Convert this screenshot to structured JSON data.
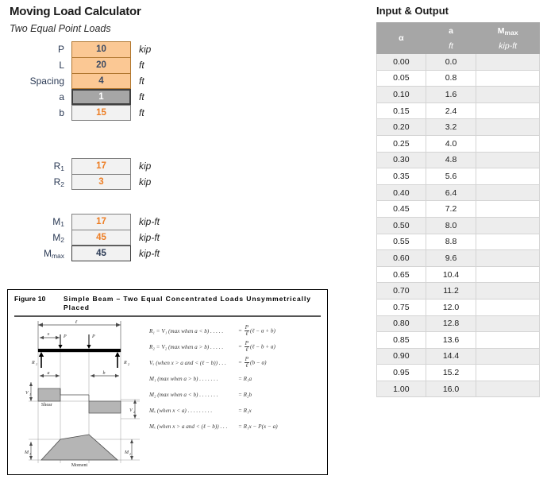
{
  "app": {
    "title": "Moving Load Calculator",
    "subtitle": "Two Equal Point Loads"
  },
  "inputs": {
    "rows": [
      {
        "label": "P",
        "value": "10",
        "unit": "kip",
        "kind": "input"
      },
      {
        "label": "L",
        "value": "20",
        "unit": "ft",
        "kind": "input"
      },
      {
        "label": "Spacing",
        "value": "4",
        "unit": "ft",
        "kind": "input"
      },
      {
        "label": "a",
        "value": "1",
        "unit": "ft",
        "kind": "selected"
      },
      {
        "label": "b",
        "value": "15",
        "unit": "ft",
        "kind": "output"
      }
    ]
  },
  "reactions": {
    "rows": [
      {
        "label": "R",
        "sub": "1",
        "value": "17",
        "unit": "kip"
      },
      {
        "label": "R",
        "sub": "2",
        "value": "3",
        "unit": "kip"
      }
    ]
  },
  "moments": {
    "rows": [
      {
        "label": "M",
        "sub": "1",
        "value": "17",
        "unit": "kip-ft"
      },
      {
        "label": "M",
        "sub": "2",
        "value": "45",
        "unit": "kip-ft"
      },
      {
        "label": "M",
        "sub": "max",
        "value": "45",
        "unit": "kip-ft"
      }
    ]
  },
  "figure": {
    "number": "Figure 10",
    "title": "Simple Beam – Two Equal Concentrated Loads Unsymmetrically Placed",
    "diagram": {
      "span_label": "ℓ",
      "load_labels": [
        "P",
        "P"
      ],
      "reaction_labels": [
        "R₁",
        "R₂"
      ],
      "dim_labels": [
        "x",
        "a",
        "b"
      ],
      "shear_label": "Shear",
      "shear_values": [
        "V₁",
        "V₂"
      ],
      "moment_label": "Moment",
      "moment_values": [
        "M₁",
        "M₂"
      ]
    },
    "equations": [
      {
        "lhs": "R₁ = V₁ (max when a < b)  . . . . .",
        "rhs_num": "P",
        "rhs_den": "ℓ",
        "rhs_tail": "(ℓ − a + b)"
      },
      {
        "lhs": "R₂ = V₂ (max when a > b) . . . . .",
        "rhs_num": "P",
        "rhs_den": "ℓ",
        "rhs_tail": "(ℓ − b + a)"
      },
      {
        "lhs": "Vₓ (when x > a and < (ℓ − b))  . . .",
        "rhs_num": "P",
        "rhs_den": "ℓ",
        "rhs_tail": "(b − a)"
      },
      {
        "lhs": "M₁ (max when a > b)  . . . . . . .",
        "rhs_plain": "R₁a"
      },
      {
        "lhs": "M₂ (max when a < b)  . . . . . . .",
        "rhs_plain": "R₂b"
      },
      {
        "lhs": "Mₓ (when x < a)  . . . . . . . . .",
        "rhs_plain": "R₁x"
      },
      {
        "lhs": "Mₓ (when x > a and < (ℓ − b))  . . .",
        "rhs_plain": "R₁x − P(x − a)"
      }
    ]
  },
  "output_table": {
    "title": "Input & Output",
    "headers": [
      {
        "symbol": "α",
        "unit": ""
      },
      {
        "symbol": "a",
        "unit": "ft"
      },
      {
        "symbol": "Mmax",
        "unit": "kip-ft"
      }
    ],
    "rows": [
      {
        "alpha": "0.00",
        "a": "0.0",
        "mmax": ""
      },
      {
        "alpha": "0.05",
        "a": "0.8",
        "mmax": ""
      },
      {
        "alpha": "0.10",
        "a": "1.6",
        "mmax": ""
      },
      {
        "alpha": "0.15",
        "a": "2.4",
        "mmax": ""
      },
      {
        "alpha": "0.20",
        "a": "3.2",
        "mmax": ""
      },
      {
        "alpha": "0.25",
        "a": "4.0",
        "mmax": ""
      },
      {
        "alpha": "0.30",
        "a": "4.8",
        "mmax": ""
      },
      {
        "alpha": "0.35",
        "a": "5.6",
        "mmax": ""
      },
      {
        "alpha": "0.40",
        "a": "6.4",
        "mmax": ""
      },
      {
        "alpha": "0.45",
        "a": "7.2",
        "mmax": ""
      },
      {
        "alpha": "0.50",
        "a": "8.0",
        "mmax": ""
      },
      {
        "alpha": "0.55",
        "a": "8.8",
        "mmax": ""
      },
      {
        "alpha": "0.60",
        "a": "9.6",
        "mmax": ""
      },
      {
        "alpha": "0.65",
        "a": "10.4",
        "mmax": ""
      },
      {
        "alpha": "0.70",
        "a": "11.2",
        "mmax": ""
      },
      {
        "alpha": "0.75",
        "a": "12.0",
        "mmax": ""
      },
      {
        "alpha": "0.80",
        "a": "12.8",
        "mmax": ""
      },
      {
        "alpha": "0.85",
        "a": "13.6",
        "mmax": ""
      },
      {
        "alpha": "0.90",
        "a": "14.4",
        "mmax": ""
      },
      {
        "alpha": "0.95",
        "a": "15.2",
        "mmax": ""
      },
      {
        "alpha": "1.00",
        "a": "16.0",
        "mmax": ""
      }
    ]
  },
  "colors": {
    "input_fill": "#FBC894",
    "selected_fill": "#A6A6A6",
    "output_fill": "#F2F2F2",
    "output_text": "#ED7D23",
    "label_text": "#2B3A55",
    "header_fill": "#A6A6A6",
    "row_alt_fill": "#EDEDED"
  }
}
